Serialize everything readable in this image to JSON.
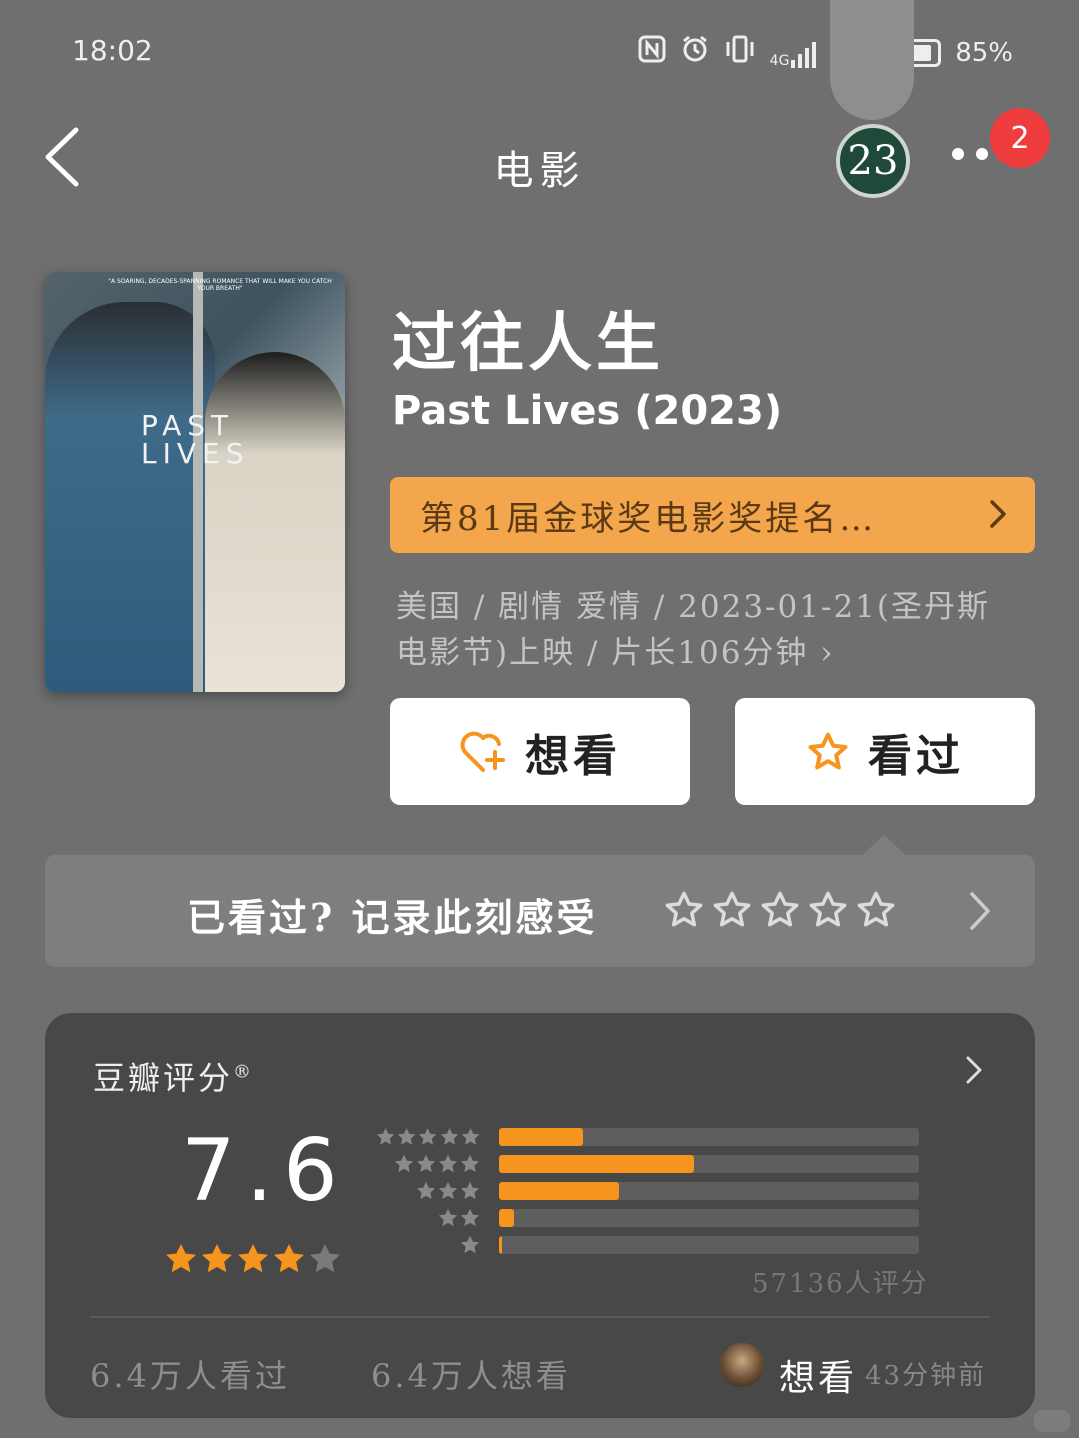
{
  "status_bar": {
    "time": "18:02",
    "network_1": "4G",
    "network_2": "4G",
    "battery": "85%"
  },
  "nav": {
    "title": "电影",
    "app_badge": "23",
    "notification_count": "2"
  },
  "poster": {
    "title_line1": "PAST",
    "title_line2": "LIVES",
    "quote": "\"A SOARING, DECADES-SPANNING ROMANCE THAT WILL MAKE YOU CATCH YOUR BREATH\""
  },
  "movie": {
    "title_cn": "过往人生",
    "title_en": "Past Lives (2023)",
    "award": "第81届金球奖电影奖提名…",
    "meta_line1": "美国 / 剧情 爱情 / 2023-01-21(圣丹斯",
    "meta_line2": "电影节)上映 / 片长106分钟 ›"
  },
  "actions": {
    "want_label": "想看",
    "seen_label": "看过"
  },
  "record": {
    "prompt": "已看过? 记录此刻感受"
  },
  "rating": {
    "label": "豆瓣评分",
    "label_mark": "®",
    "score": "7.6",
    "stars": 4,
    "distribution": [
      {
        "stars": 5,
        "fraction": 0.2
      },
      {
        "stars": 4,
        "fraction": 0.465
      },
      {
        "stars": 3,
        "fraction": 0.285
      },
      {
        "stars": 2,
        "fraction": 0.035
      },
      {
        "stars": 1,
        "fraction": 0.008
      }
    ],
    "count_text": "57136人评分",
    "seen_count": "6.4万人看过",
    "want_count": "6.4万人想看",
    "friend_action": "想看",
    "friend_time": "43分钟前"
  },
  "colors": {
    "accent": "#f7941d",
    "award_bg": "#f4a64c",
    "badge": "#ef3c3c",
    "background": "#6f6f6f"
  },
  "icons": [
    "back-arrow-icon",
    "more-dots-icon",
    "heart-plus-icon",
    "star-icon",
    "chevron-right-icon"
  ]
}
